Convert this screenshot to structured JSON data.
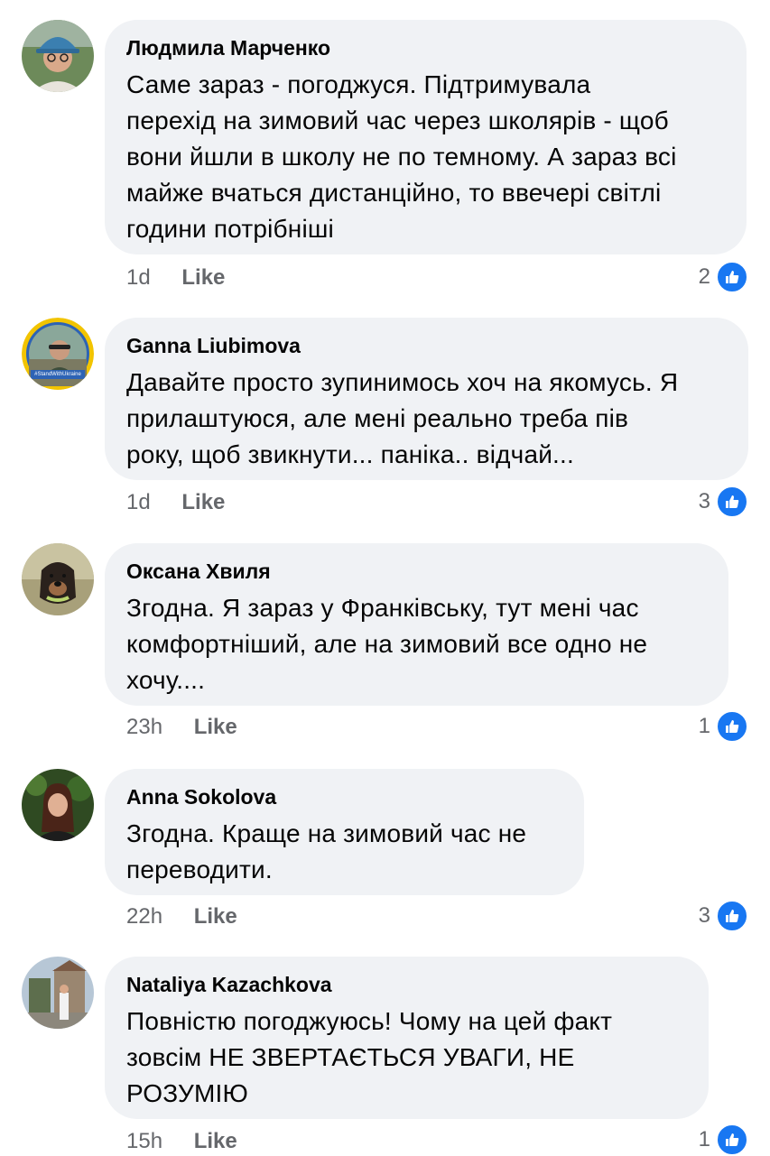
{
  "comments": [
    {
      "author": "Людмила Марченко",
      "lines": [
        "Саме зараз - погоджуся. Підтримувала",
        "перехід на зимовий час через школярів - щоб",
        "вони йшли в школу не по темному. А зараз всі",
        "майже вчаться дистанційно, то ввечері світлі",
        "години потрібніші"
      ],
      "time": "1d",
      "like_label": "Like",
      "reaction_count": "2",
      "avatar_icon": "user-photo-hat-glasses"
    },
    {
      "author": "Ganna Liubimova",
      "lines": [
        "Давайте просто зупинимось хоч на якомусь. Я",
        "прилаштуюся, але мені реально треба пів",
        "року, щоб звикнути... паніка.. відчай..."
      ],
      "time": "1d",
      "like_label": "Like",
      "reaction_count": "3",
      "avatar_icon": "user-photo-standwithukraine-frame",
      "avatar_badge_text": "#StandWithUkraine"
    },
    {
      "author": "Оксана Хвиля",
      "lines": [
        "Згодна.  Я зараз у Франківську,  тут мені час",
        "комфортніший,  але  на зимовий все одно не",
        "хочу...."
      ],
      "time": "23h",
      "like_label": "Like",
      "reaction_count": "1",
      "avatar_icon": "dog-photo"
    },
    {
      "author": "Anna  Sokolova",
      "lines": [
        "Згодна. Краще на зимовий час не",
        "переводити."
      ],
      "time": "22h",
      "like_label": "Like",
      "reaction_count": "3",
      "avatar_icon": "user-photo-woman"
    },
    {
      "author": "Nataliya Kazachkova",
      "lines": [
        "Повністю  погоджуюсь! Чому  на  цей  факт",
        "зовсім  НЕ  ЗВЕРТАЄТЬСЯ  УВАГИ,  НЕ",
        "РОЗУМІЮ"
      ],
      "time": "15h",
      "like_label": "Like",
      "reaction_count": "1",
      "avatar_icon": "user-photo-town-square"
    }
  ],
  "colors": {
    "bubble": "#f0f2f5",
    "meta_text": "#65676b",
    "like_blue": "#1877f2",
    "body_text": "#050505"
  }
}
